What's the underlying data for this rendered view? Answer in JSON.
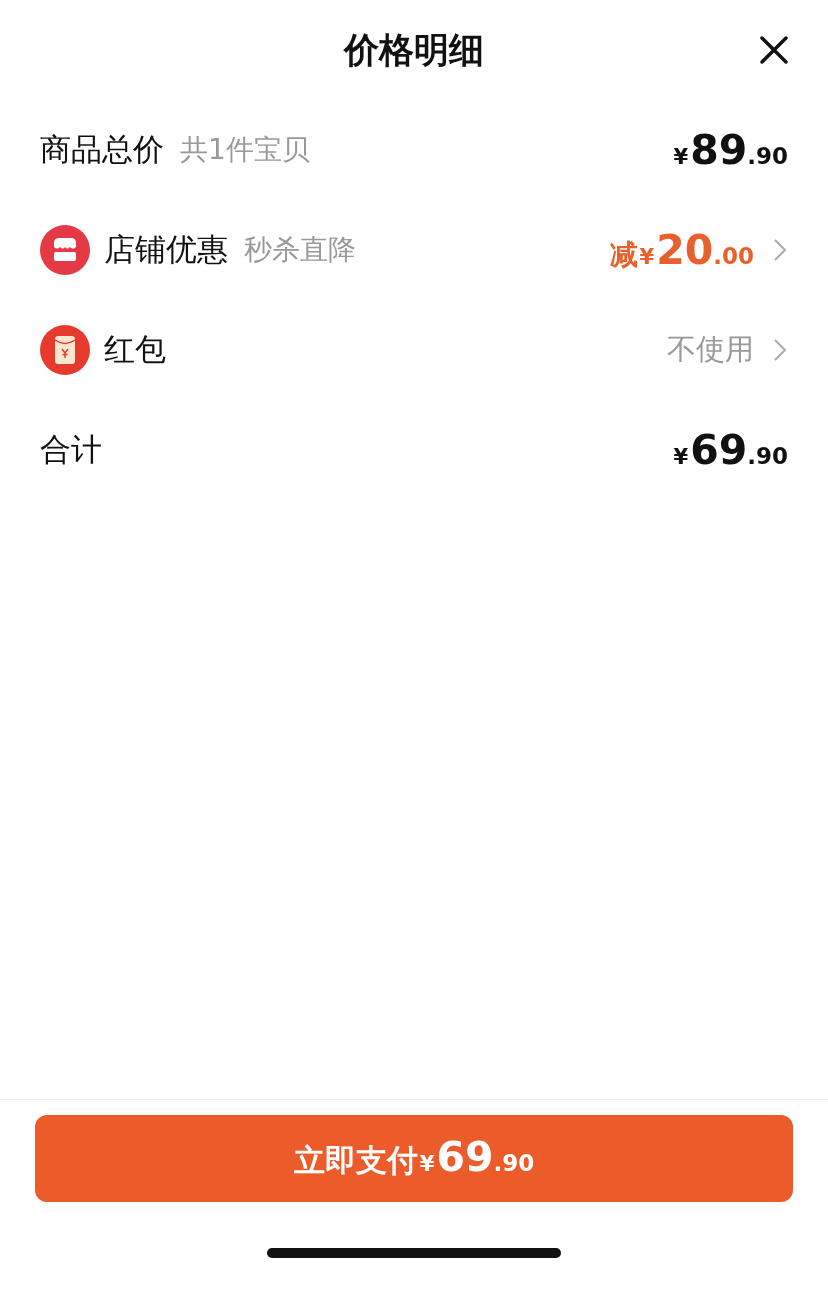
{
  "header": {
    "title": "价格明细"
  },
  "rows": [
    {
      "kind": "plain",
      "label": "商品总价",
      "note": "共1件宝贝",
      "price": {
        "currency": "¥",
        "integer": "89",
        "decimal": ".90",
        "accent": false
      },
      "chevron": false
    },
    {
      "kind": "shop",
      "label": "店铺优惠",
      "note": "秒杀直降",
      "price": {
        "prefix": "减",
        "currency": "¥",
        "integer": "20",
        "decimal": ".00",
        "accent": true
      },
      "chevron": true
    },
    {
      "kind": "red-envelope",
      "label": "红包",
      "value": "不使用",
      "chevron": true
    },
    {
      "kind": "plain",
      "label": "合计",
      "price": {
        "currency": "¥",
        "integer": "69",
        "decimal": ".90",
        "accent": false
      },
      "chevron": false
    }
  ],
  "pay_button": {
    "label": "立即支付",
    "currency": "¥",
    "integer": "69",
    "decimal": ".90"
  }
}
